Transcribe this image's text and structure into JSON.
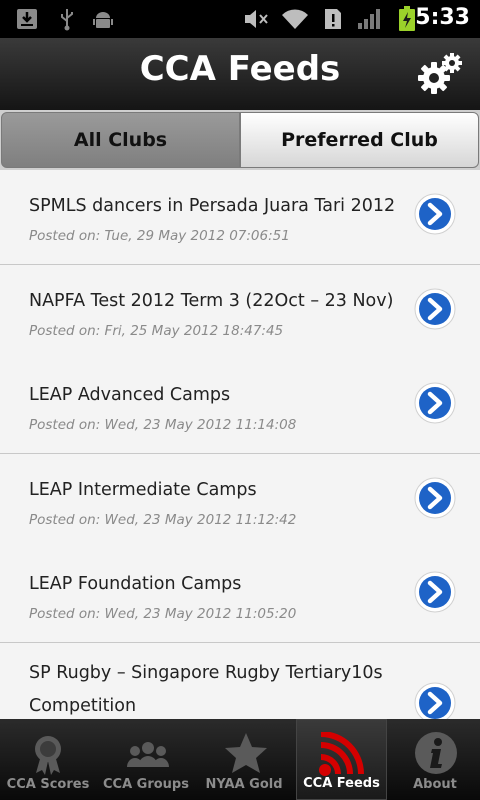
{
  "status_bar": {
    "time": "5:33"
  },
  "header": {
    "title": "CCA Feeds",
    "settings_icon": "gear-icon"
  },
  "segments": {
    "all": "All Clubs",
    "preferred": "Preferred Club"
  },
  "feeds": [
    {
      "title": "SPMLS dancers in Persada Juara Tari 2012",
      "posted": "Posted on: Tue, 29 May 2012 07:06:51"
    },
    {
      "title": "NAPFA Test 2012 Term 3 (22Oct – 23 Nov)",
      "posted": "Posted on: Fri, 25 May 2012 18:47:45"
    },
    {
      "title": "LEAP Advanced Camps",
      "posted": "Posted on: Wed, 23 May 2012 11:14:08"
    },
    {
      "title": "LEAP Intermediate Camps",
      "posted": "Posted on: Wed, 23 May 2012 11:12:42"
    },
    {
      "title": "LEAP Foundation Camps",
      "posted": "Posted on: Wed, 23 May 2012 11:05:20"
    },
    {
      "title": "SP Rugby – Singapore Rugby Tertiary10s Competition",
      "posted": ""
    }
  ],
  "tabs": [
    {
      "label": "CCA Scores",
      "icon": "medal-icon"
    },
    {
      "label": "CCA Groups",
      "icon": "people-icon"
    },
    {
      "label": "NYAA Gold",
      "icon": "star-icon"
    },
    {
      "label": "CCA Feeds",
      "icon": "rss-icon"
    },
    {
      "label": "About",
      "icon": "info-icon"
    }
  ],
  "colors": {
    "accent_red": "#d40000",
    "arrow_blue": "#1e63c7"
  }
}
